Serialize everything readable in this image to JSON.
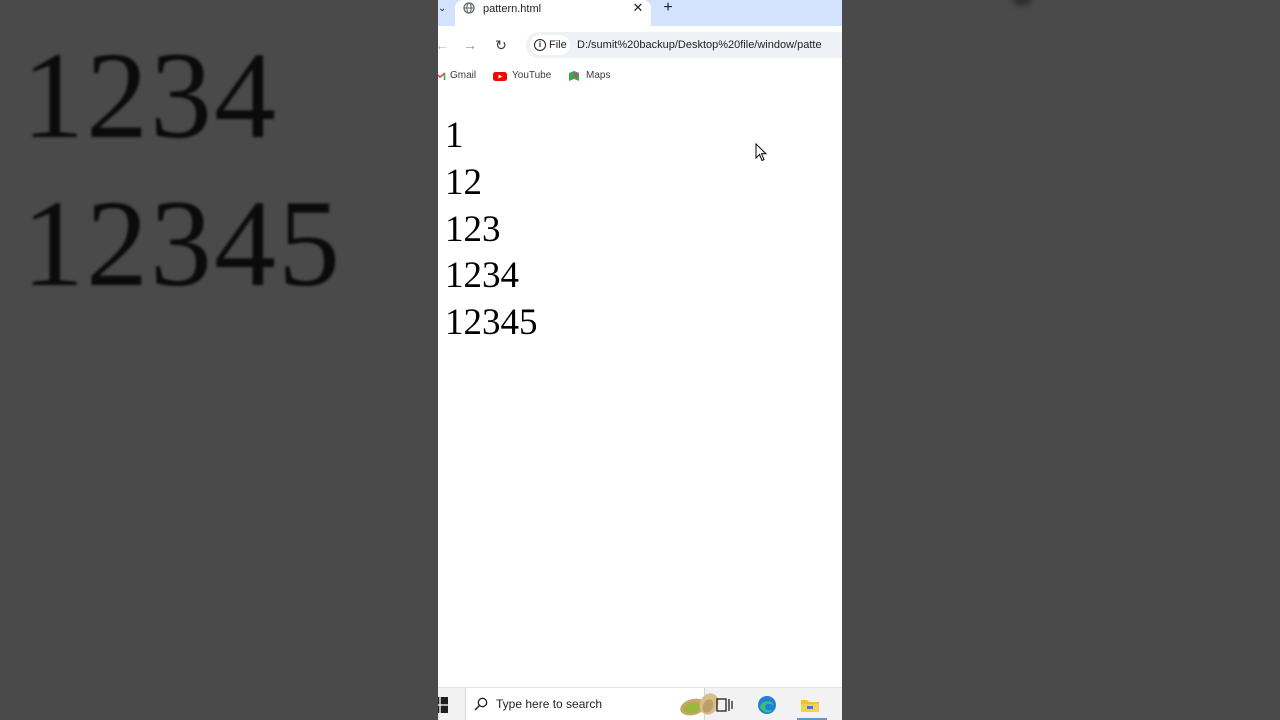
{
  "background": {
    "line_1": "1234",
    "line_2": "12345"
  },
  "browser": {
    "tab": {
      "title": "pattern.html",
      "close_glyph": "✕",
      "icon": "globe-icon"
    },
    "new_tab_glyph": "+",
    "tab_dropdown_glyph": "⌄",
    "toolbar": {
      "back_glyph": "←",
      "forward_glyph": "→",
      "reload_glyph": "↻",
      "site_chip_label": "File",
      "url": "D:/sumit%20backup/Desktop%20file/window/patte"
    },
    "bookmarks": [
      {
        "label": "Gmail",
        "icon": "gmail-icon"
      },
      {
        "label": "YouTube",
        "icon": "youtube-icon"
      },
      {
        "label": "Maps",
        "icon": "maps-icon"
      }
    ]
  },
  "page": {
    "lines": [
      "1",
      "12",
      "123",
      "1234",
      "12345"
    ]
  },
  "taskbar": {
    "search_placeholder": "Type here to search",
    "icons": [
      "windows-start-icon",
      "task-view-icon",
      "edge-icon",
      "file-explorer-icon"
    ]
  },
  "colors": {
    "tabstrip": "#d3e3fd",
    "desktop_bg": "#4a4a4a",
    "taskbar": "#f2f2f2",
    "edge_blue": "#1e7fd6",
    "youtube_red": "#ff0000"
  }
}
